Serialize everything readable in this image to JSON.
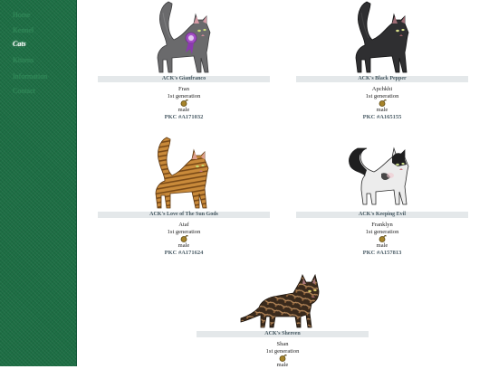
{
  "sidebar": {
    "items": [
      {
        "label": "Home",
        "active": false
      },
      {
        "label": "Kennel",
        "active": false
      },
      {
        "label": "Cats",
        "active": true
      },
      {
        "label": "Kittens",
        "active": false
      },
      {
        "label": "Information",
        "active": false
      },
      {
        "label": "Contact",
        "active": false
      }
    ]
  },
  "cats": [
    {
      "name": "ACK's Gianfranco",
      "owner": "Fran",
      "generation": "1st generation",
      "sex": "male",
      "pkc": "PKC #A171032",
      "coat": "grey",
      "ribbon": true
    },
    {
      "name": "ACK's Black Pepper",
      "owner": "Apchkhi",
      "generation": "1st generation",
      "sex": "male",
      "pkc": "PKC #A165155",
      "coat": "black",
      "ribbon": false
    },
    {
      "name": "ACK's Love of The Sun Gods",
      "owner": "Ataf",
      "generation": "1st generation",
      "sex": "male",
      "pkc": "PKC #A171624",
      "coat": "tabby",
      "ribbon": false
    },
    {
      "name": "ACK's Keeping Evil",
      "owner": "Franklyn",
      "generation": "1st generation",
      "sex": "male",
      "pkc": "PKC #A157813",
      "coat": "bicolor",
      "ribbon": false
    },
    {
      "name": "ACK's Shereen",
      "owner": "Shan",
      "generation": "1st generation",
      "sex": "male",
      "pkc": "",
      "coat": "tortie",
      "ribbon": false
    }
  ],
  "colors": {
    "sidebar": "#1d6e44",
    "name_bar": "#e4e8ea",
    "pkc_text": "#4a5c66"
  }
}
